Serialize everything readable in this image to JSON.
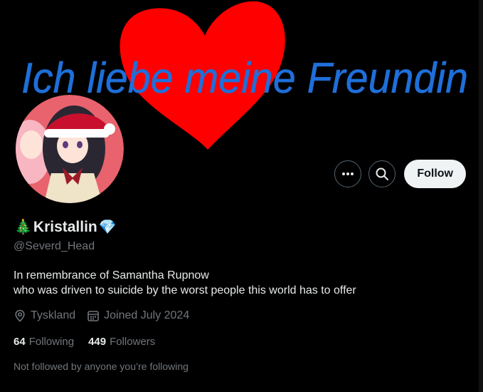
{
  "banner": {
    "handwriting": "Ich liebe meine Freundin",
    "heart_color": "#ff0000",
    "handwriting_color": "#1e6fd9"
  },
  "profile": {
    "display_name": "Kristallin",
    "leading_emoji": "🎄",
    "trailing_emoji": "💎",
    "handle": "@Severd_Head",
    "bio_line1": "In remembrance of Samantha Rupnow",
    "bio_line2": "who was driven to suicide by the worst people this world has to offer",
    "location": "Tyskland",
    "joined": "Joined July 2024",
    "following_count": "64",
    "following_label": "Following",
    "followers_count": "449",
    "followers_label": "Followers",
    "not_followed_text": "Not followed by anyone you’re following"
  },
  "actions": {
    "more_icon": "more-horizontal-icon",
    "search_icon": "search-icon",
    "follow_label": "Follow"
  },
  "colors": {
    "background": "#000000",
    "primary_text": "#e7e9ea",
    "secondary_text": "#71767b",
    "follow_bg": "#eff3f4",
    "border": "#536471"
  }
}
